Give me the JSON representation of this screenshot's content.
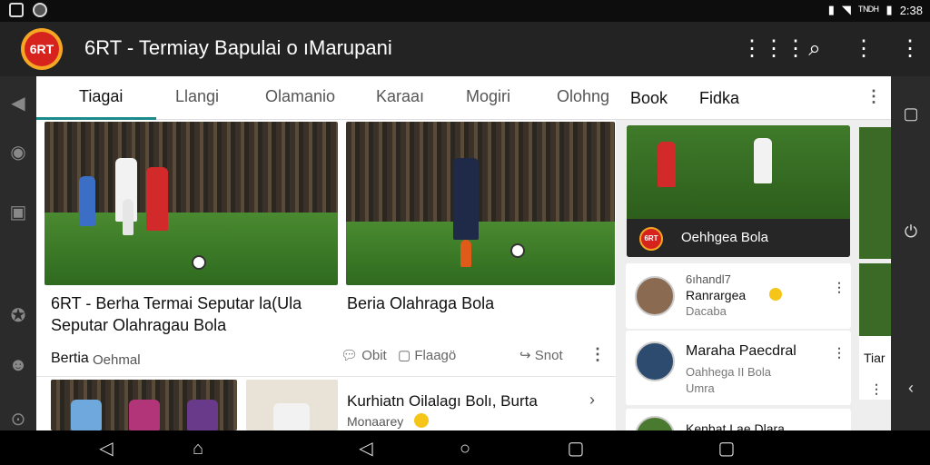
{
  "status_bar": {
    "time": "2:38",
    "signal_text": "ᵀᴺᴰᴴ"
  },
  "app": {
    "logo_text": "6RT",
    "title": "6RT - Termiay Bapulai o ıMarupani"
  },
  "tabs": [
    {
      "label": "Tiagai",
      "active": true
    },
    {
      "label": "Llangi",
      "active": false
    },
    {
      "label": "Olamanio",
      "active": false
    },
    {
      "label": "Karaaı",
      "active": false
    },
    {
      "label": "Mogiri",
      "active": false
    },
    {
      "label": "Olohng",
      "active": false
    }
  ],
  "articles": [
    {
      "title": "6RT - Berha Termai Seputar la(Ula Seputar Olahragau Bola",
      "meta": "Bertia",
      "meta_source": "Oehmal"
    },
    {
      "title": "Beria Olahraga Bola"
    }
  ],
  "article_actions": {
    "comment": "Obit",
    "bookmark": "Flaagö",
    "share": "Snot"
  },
  "bottom_article": {
    "title": "Kurhiatn Oilalagı Bolı, Burta",
    "author": "Monaarey"
  },
  "side": {
    "tabs": [
      "Book",
      "Fidka"
    ],
    "feature_caption": "Oehhgea Bola",
    "feature_logo": "6RT",
    "list": [
      {
        "name": "Ranrargea",
        "line1": "6ıhandl7",
        "sub": "Dacaba"
      },
      {
        "name": "Maraha Paecdral",
        "sub": "Oahhega II Bola",
        "sub2": "Umra"
      },
      {
        "name": "Kenbat Lae Dlara"
      }
    ],
    "strip_text": "Tiar"
  },
  "colors": {
    "accent": "#1a8a8a",
    "brand_red": "#d6231e",
    "brand_orange": "#f5a623"
  }
}
